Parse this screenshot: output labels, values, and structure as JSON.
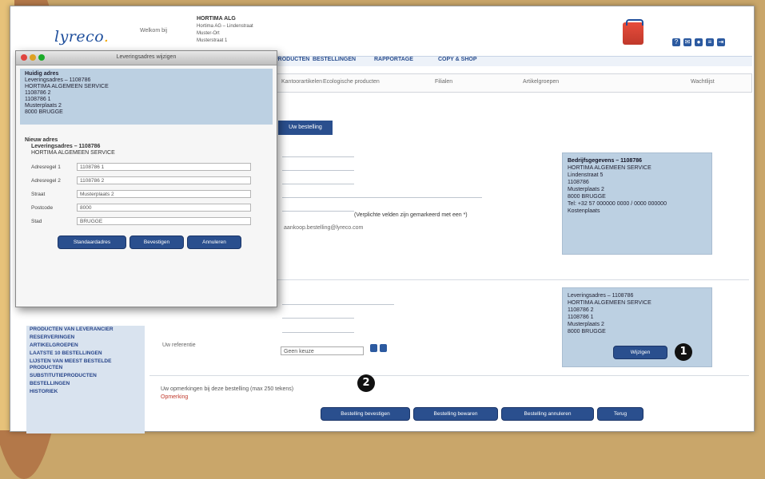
{
  "header": {
    "logo": "lyreco",
    "welcome": "Welkom bij",
    "account_lines": [
      "HORTIMA ALG",
      "Hortima AG – Lindenstraat",
      "Muster-Ort",
      "Musterstraat 1"
    ]
  },
  "nav": {
    "items": [
      "PRODUCTEN",
      "BESTELLINGEN",
      "RAPPORTAGE",
      "COPY & SHOP"
    ]
  },
  "subnav": {
    "items": [
      "Kantoorartikelen",
      "Ecologische producten",
      "Filialen",
      "Artikelgroepen",
      "Wachtlijst"
    ]
  },
  "tab_button": "Uw bestelling",
  "required_note": "(Verplichte velden zijn gemarkeerd met een *)",
  "email_value": "aankoop.bestelling@lyreco.com",
  "delivery_box": {
    "lines": [
      "Bedrijfsgegevens – 1108786",
      "HORTIMA ALGEMEEN SERVICE",
      "Lindenstraat 5",
      "1108786",
      "Musterplaats 2",
      "8000 BRUGGE",
      "Tel: +32 57 000000 0000 / 0000 000000",
      "Kostenplaats"
    ]
  },
  "invoice_box": {
    "lines": [
      "Leveringsadres – 1108786",
      "HORTIMA ALGEMEEN SERVICE",
      "1108786 2",
      "1108786 1",
      "Musterplaats 2",
      "8000 BRUGGE"
    ],
    "button": "Wijzigen"
  },
  "left_menu": [
    "PRODUCTEN VAN LEVERANCIER",
    "RESERVERINGEN",
    "ARTIKELGROEPEN",
    "LAATSTE 10 BESTELLINGEN",
    "LIJSTEN VAN MEEST BESTELDE PRODUCTEN",
    "SUBSTITUTIEPRODUCTEN",
    "BESTELLINGEN",
    "HISTORIEK"
  ],
  "lower_form": {
    "label": "Uw referentie",
    "select_value": "Geen keuze",
    "note": "Uw opmerkingen bij deze bestelling (max 250 tekens)",
    "note_red": "Opmerking"
  },
  "bottom_buttons": [
    "Bestelling bevestigen",
    "Bestelling bewaren",
    "Bestelling annuleren",
    "Terug"
  ],
  "dialog": {
    "title": "Leveringsadres wijzigen",
    "current_heading": "Huidig adres",
    "current_lines": [
      "Leveringsadres – 1108786",
      "HORTIMA ALGEMEEN SERVICE",
      "1108786 2",
      "1108786 1",
      "Musterplaats 2",
      "8000 BRUGGE"
    ],
    "new_heading": "Nieuw adres",
    "new_sub": "Leveringsadres – 1108786",
    "new_sub2": "HORTIMA ALGEMEEN SERVICE",
    "fields": [
      {
        "label": "Adresregel 1",
        "value": "1108786 1"
      },
      {
        "label": "Adresregel 2",
        "value": "1108786 2"
      },
      {
        "label": "Straat",
        "value": "Musterplaats 2"
      },
      {
        "label": "Postcode",
        "value": "8000"
      },
      {
        "label": "Stad",
        "value": "BRUGGE"
      }
    ],
    "buttons": [
      "Standaardadres",
      "Bevestigen",
      "Annuleren"
    ]
  },
  "callouts": [
    "1",
    "1",
    "2"
  ]
}
